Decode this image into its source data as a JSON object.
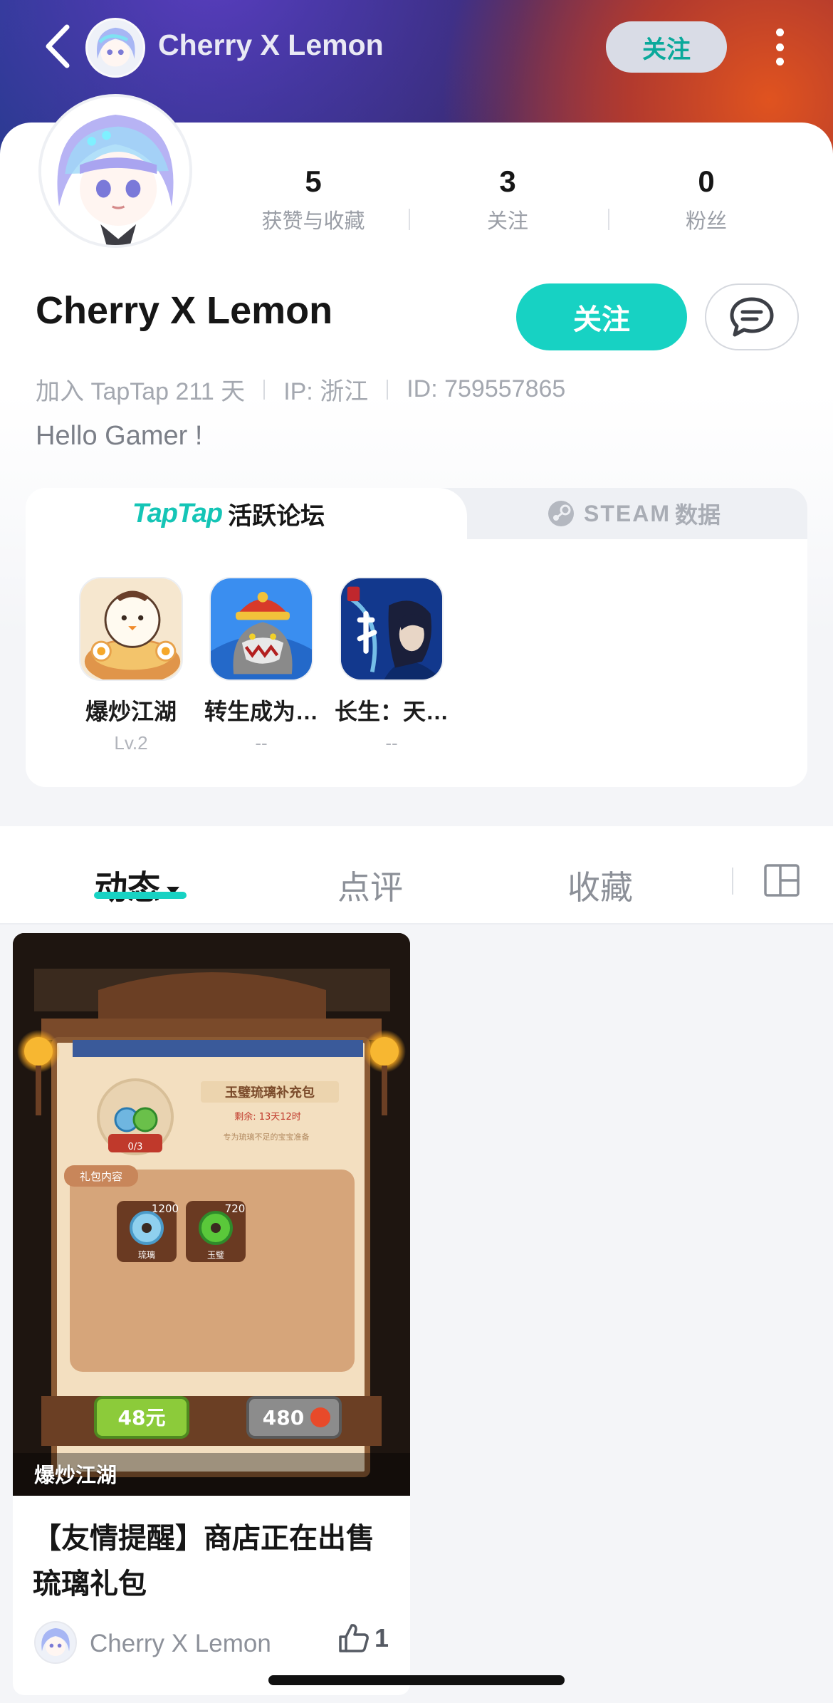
{
  "header": {
    "title": "Cherry X Lemon",
    "follow_label": "关注"
  },
  "profile": {
    "name": "Cherry X Lemon",
    "stats": [
      {
        "value": "5",
        "label": "获赞与收藏"
      },
      {
        "value": "3",
        "label": "关注"
      },
      {
        "value": "0",
        "label": "粉丝"
      }
    ],
    "follow_label": "关注",
    "joined": "加入 TapTap 211 天",
    "ip": "IP: 浙江",
    "id": "ID: 759557865",
    "bio": "Hello Gamer !"
  },
  "forum": {
    "tab_active_logo": "TapTap",
    "tab_active_label": "活跃论坛",
    "tab_steam_logo": "STEAM",
    "tab_steam_label": "数据",
    "games": [
      {
        "name": "爆炒江湖",
        "level": "Lv.2"
      },
      {
        "name": "转生成为…",
        "level": "--"
      },
      {
        "name": "长生：天…",
        "level": "--"
      }
    ]
  },
  "content_tabs": {
    "tabs": [
      "动态",
      "点评",
      "收藏"
    ],
    "active": "动态"
  },
  "post": {
    "game_tag": "爆炒江湖",
    "title": "【友情提醒】商店正在出售琉璃礼包",
    "author": "Cherry X Lemon",
    "likes": "1",
    "image_texts": {
      "pack_title": "玉璧琉璃补充包",
      "remaining": "剩余: 13天12时",
      "desc": "专为琉璃不足的宝宝准备",
      "progress": "0/3",
      "contents_label": "礼包内容",
      "item1_count": "1200",
      "item1_name": "琉璃",
      "item2_count": "720",
      "item2_name": "玉璧",
      "price_rmb": "48元",
      "price_coin": "480"
    }
  },
  "colors": {
    "accent": "#17d2c3",
    "accent_dark": "#0aa99b"
  }
}
